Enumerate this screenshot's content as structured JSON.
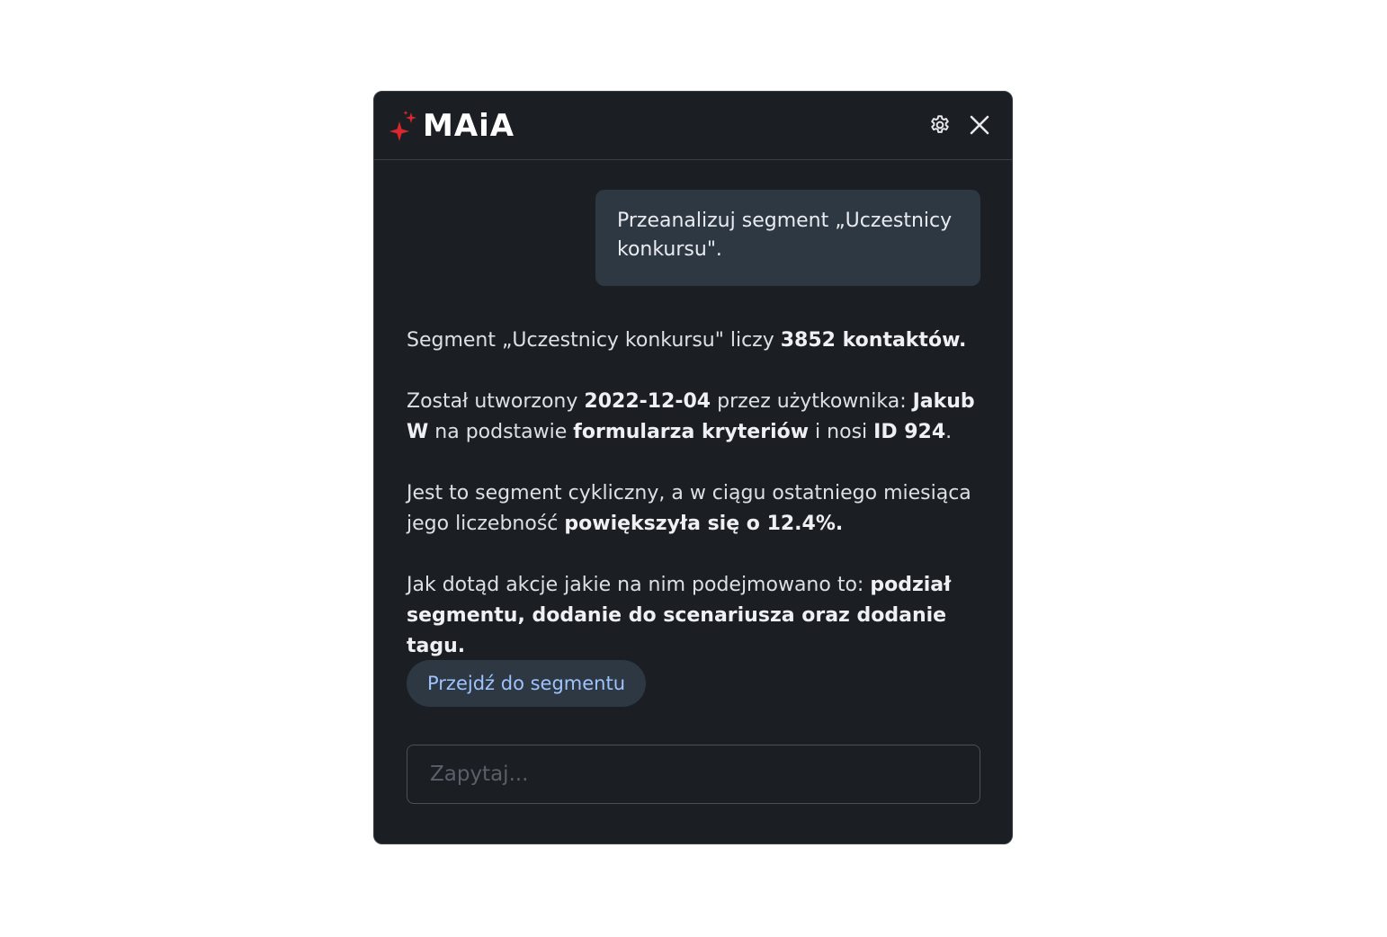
{
  "header": {
    "brand": "MAiA",
    "icons": {
      "logo": "sparkle-icon",
      "settings": "gear-icon",
      "close": "close-icon"
    },
    "colors": {
      "logo_sparkle": "#d9272e",
      "background": "#1b1e23"
    }
  },
  "chat": {
    "user_message": "Przeanalizuj segment „Uczestnicy konkursu\".",
    "answer": {
      "p1": {
        "t1": "Segment „Uczestnicy konkursu\" liczy ",
        "b1": "3852 kontaktów."
      },
      "p2": {
        "t1": "Został utworzony ",
        "b1": "2022-12-04",
        "t2": " przez użytkownika: ",
        "b2": "Jakub W",
        "t3": " na podstawie ",
        "b3": "formularza kryteriów",
        "t4": " i nosi ",
        "b4": "ID 924",
        "t5": "."
      },
      "p3": {
        "t1": "Jest to segment cykliczny, a w ciągu ostatniego miesiąca jego liczebność ",
        "b1": "powiększyła się o 12.4%."
      },
      "p4": {
        "t1": "Jak dotąd akcje jakie na nim podejmowano to: ",
        "b1": "podział segmentu, dodanie do scenariusza oraz dodanie tagu."
      }
    },
    "action_button": "Przejdź do segmentu"
  },
  "input": {
    "placeholder": "Zapytaj...",
    "value": ""
  }
}
